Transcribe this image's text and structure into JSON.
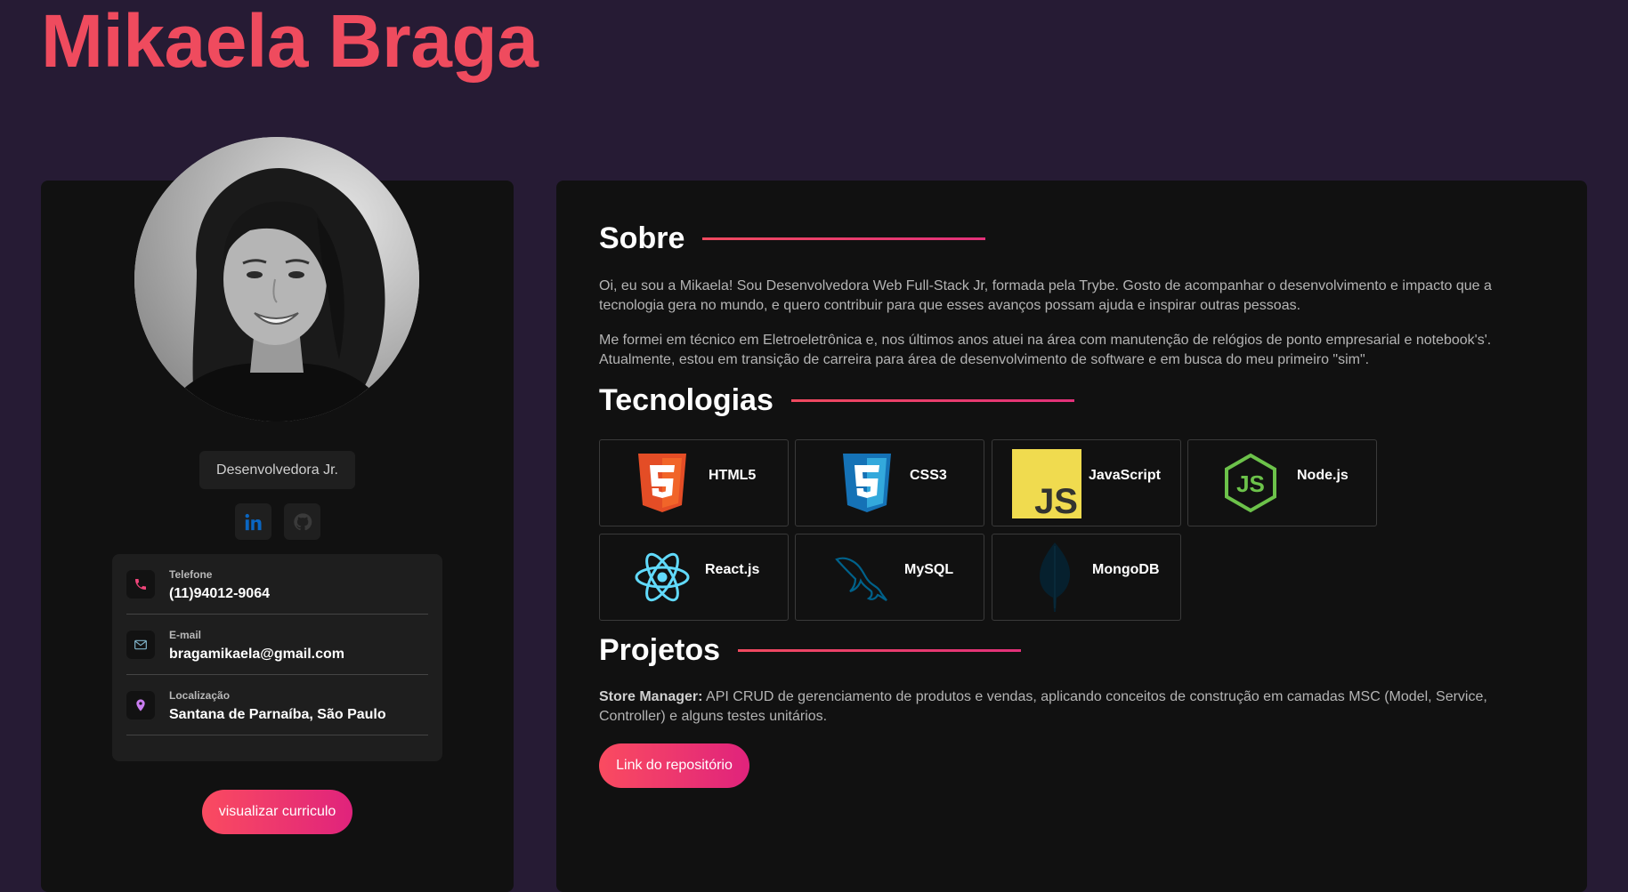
{
  "header": {
    "name": "Mikaela Braga"
  },
  "profile": {
    "role": "Desenvolvedora Jr.",
    "social": [
      "linkedin-icon",
      "github-icon"
    ],
    "contacts": [
      {
        "label": "Telefone",
        "value": "(11)94012-9064",
        "icon": "phone-icon"
      },
      {
        "label": "E-mail",
        "value": "bragamikaela@gmail.com",
        "icon": "mail-icon"
      },
      {
        "label": "Localização",
        "value": "Santana de Parnaíba, São Paulo",
        "icon": "location-pin-icon"
      }
    ],
    "cv_button": "visualizar curriculo"
  },
  "about": {
    "title": "Sobre",
    "p1": "Oi, eu sou a Mikaela! Sou Desenvolvedora Web Full-Stack Jr, formada pela Trybe. Gosto de acompanhar o desenvolvimento e impacto que a tecnologia gera no mundo, e quero contribuir para que esses avanços possam ajuda e inspirar outras pessoas.",
    "p2": "Me formei em técnico em Eletroeletrônica e, nos últimos anos atuei na área com manutenção de relógios de ponto empresarial e notebook's'. Atualmente, estou em transição de carreira para área de desenvolvimento de software e em busca do meu primeiro \"sim\"."
  },
  "technologies": {
    "title": "Tecnologias",
    "items": [
      {
        "name": "HTML5",
        "icon": "html5-icon"
      },
      {
        "name": "CSS3",
        "icon": "css3-icon"
      },
      {
        "name": "JavaScript",
        "icon": "javascript-icon"
      },
      {
        "name": "Node.js",
        "icon": "nodejs-icon"
      },
      {
        "name": "React.js",
        "icon": "react-icon"
      },
      {
        "name": "MySQL",
        "icon": "mysql-dolphin-icon"
      },
      {
        "name": "MongoDB",
        "icon": "mongodb-leaf-icon"
      }
    ]
  },
  "projects": {
    "title": "Projetos",
    "project_name": "Store Manager:",
    "project_desc": " API CRUD de gerenciamento de produtos e vendas, aplicando conceitos de construção em camadas MSC (Model, Service, Controller) e alguns testes unitários.",
    "repo_button": "Link do repositório"
  },
  "colors": {
    "background": "#261b34",
    "card": "#111111",
    "accent": "#ef4b5e",
    "accent_gradient_end": "#e0237c"
  }
}
